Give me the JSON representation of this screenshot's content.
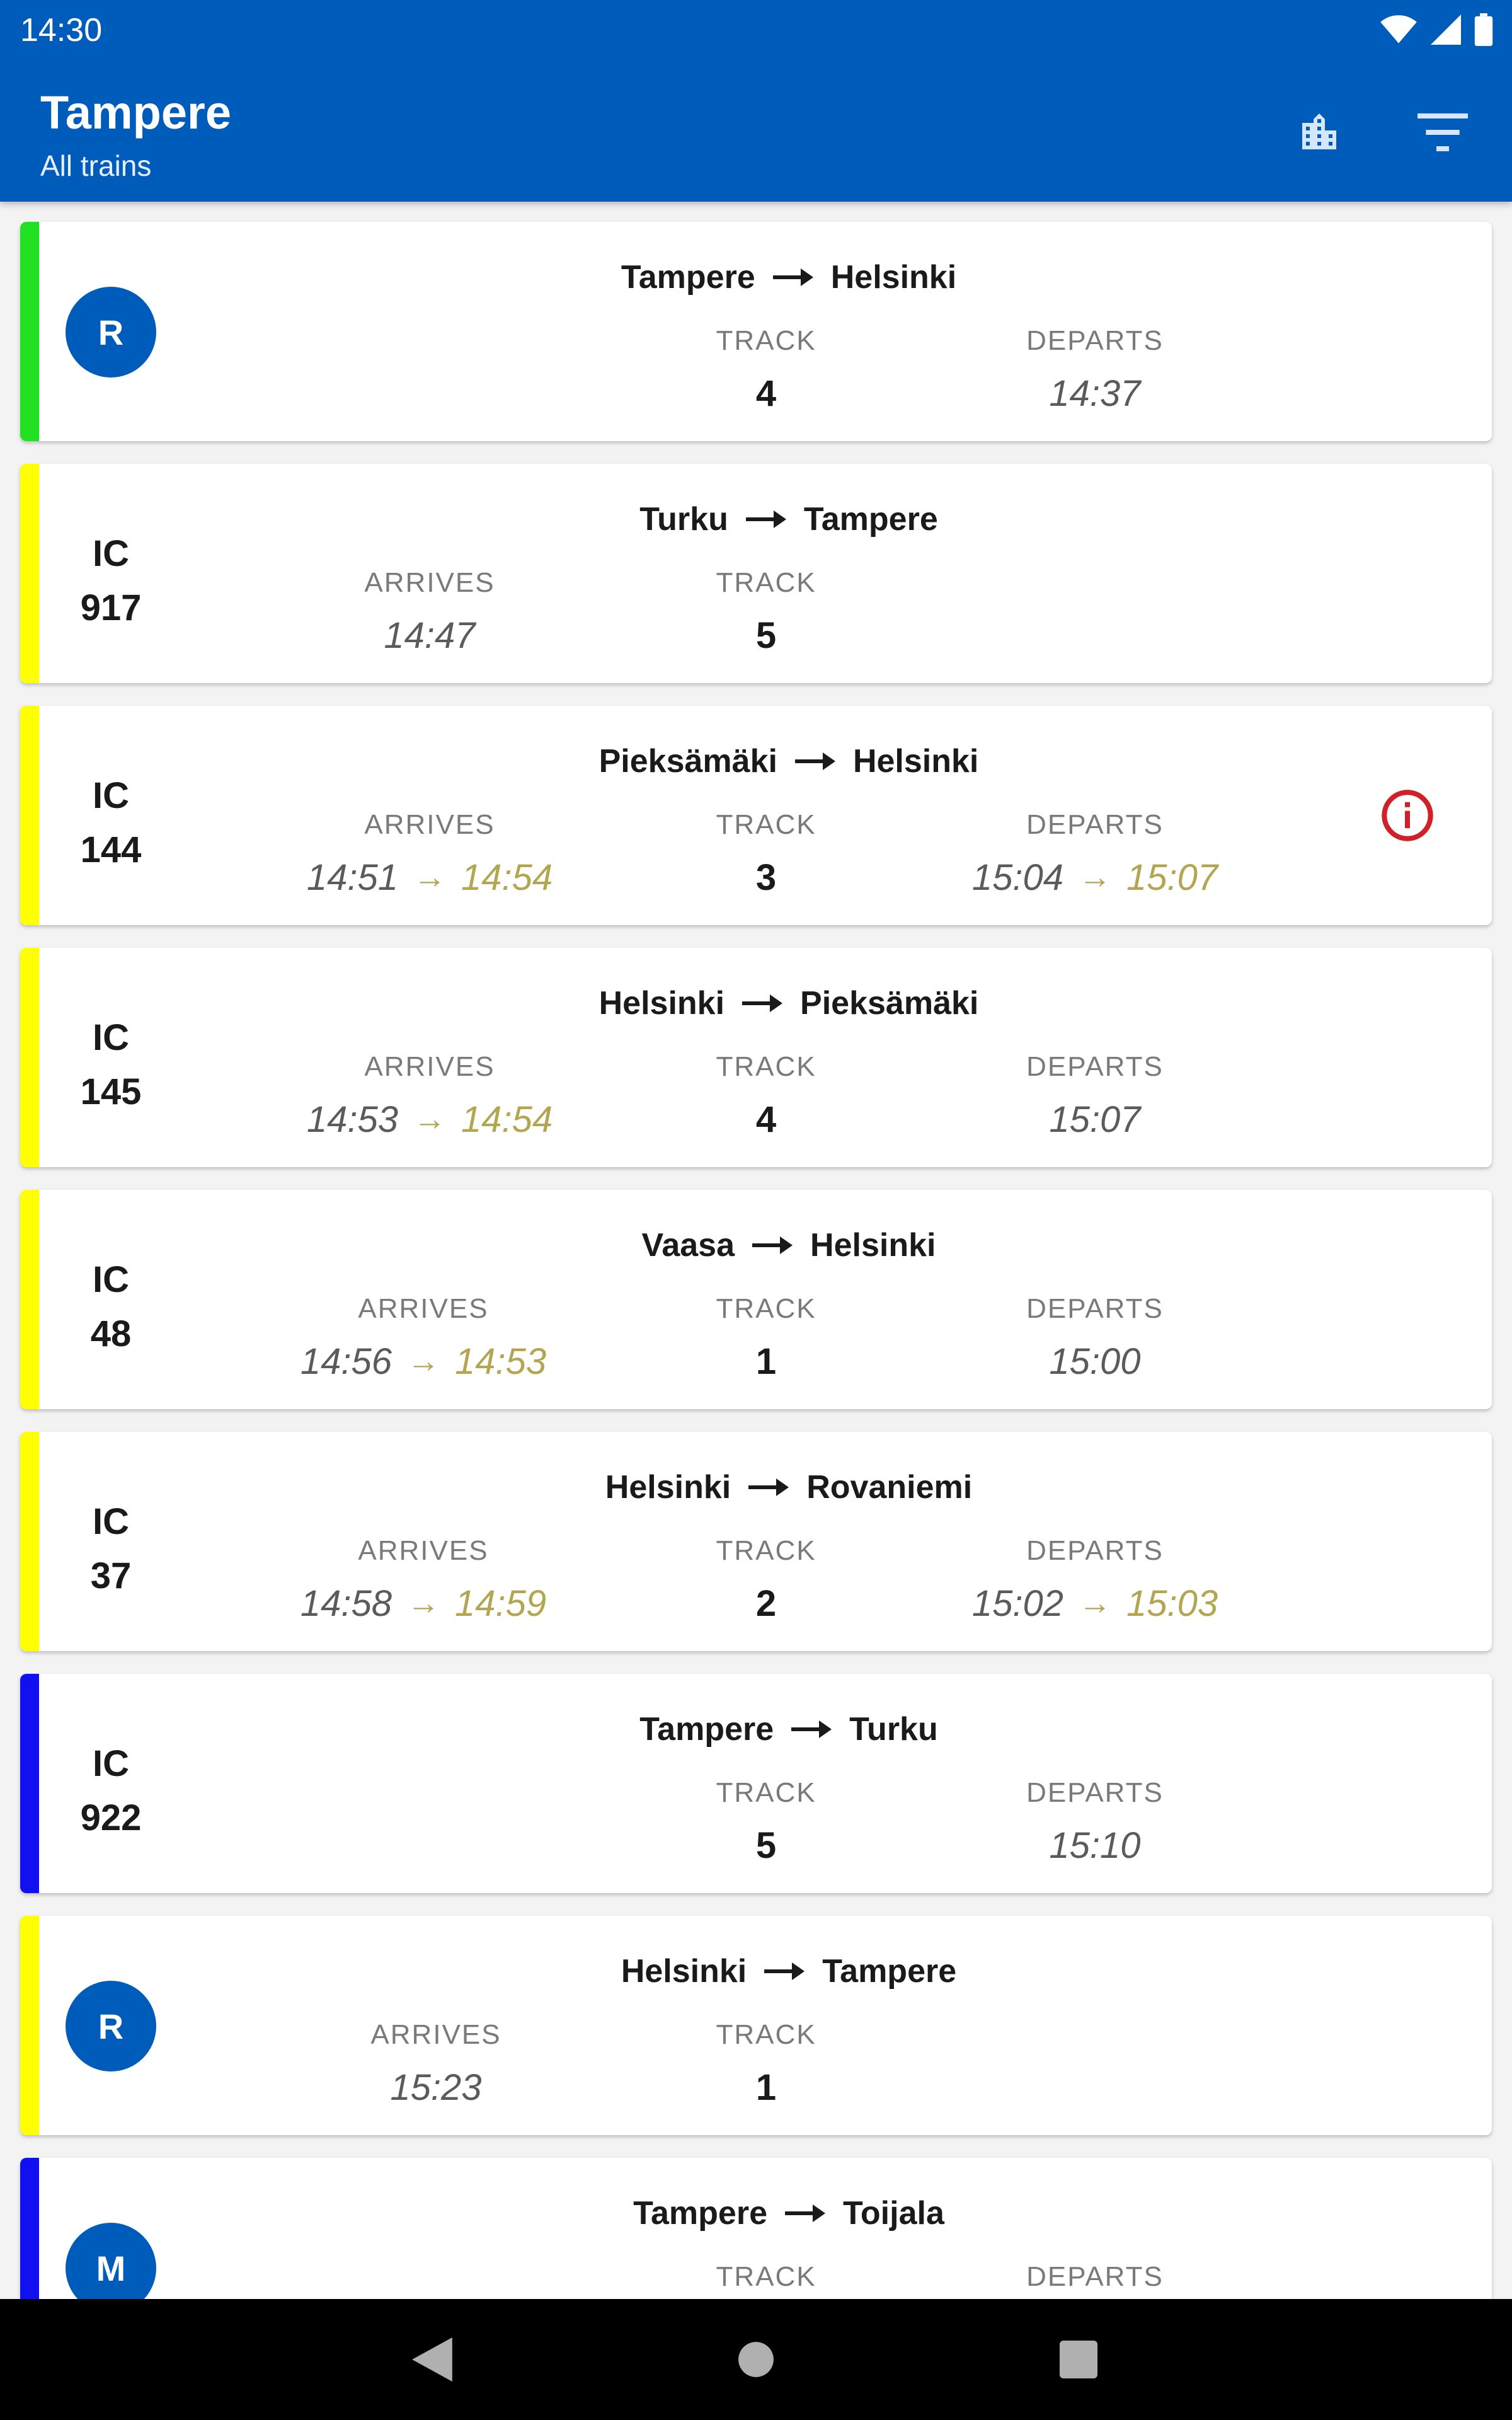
{
  "status": {
    "time": "14:30"
  },
  "appbar": {
    "title": "Tampere",
    "subtitle": "All trains"
  },
  "labels": {
    "arrives": "ARRIVES",
    "track": "TRACK",
    "departs": "DEPARTS"
  },
  "colors": {
    "primary": "#005cba",
    "delay": "#b3a651",
    "alert": "#d0202a",
    "stripe_green": "#22e022",
    "stripe_yellow": "#ffff00",
    "stripe_blue": "#1010f0"
  },
  "trains": [
    {
      "badge": "R",
      "from": "Tampere",
      "to": "Helsinki",
      "track": "4",
      "departs": "14:37",
      "stripe": "green"
    },
    {
      "type": "IC",
      "number": "917",
      "from": "Turku",
      "to": "Tampere",
      "arrives": "14:47",
      "track": "5",
      "stripe": "yellow"
    },
    {
      "type": "IC",
      "number": "144",
      "from": "Pieksämäki",
      "to": "Helsinki",
      "arrives": "14:51",
      "arrives_new": "14:54",
      "track": "3",
      "departs": "15:04",
      "departs_new": "15:07",
      "stripe": "yellow",
      "alert": true
    },
    {
      "type": "IC",
      "number": "145",
      "from": "Helsinki",
      "to": "Pieksämäki",
      "arrives": "14:53",
      "arrives_new": "14:54",
      "track": "4",
      "departs": "15:07",
      "stripe": "yellow"
    },
    {
      "type": "IC",
      "number": "48",
      "from": "Vaasa",
      "to": "Helsinki",
      "arrives": "14:56",
      "arrives_new": "14:53",
      "track": "1",
      "departs": "15:00",
      "stripe": "yellow"
    },
    {
      "type": "IC",
      "number": "37",
      "from": "Helsinki",
      "to": "Rovaniemi",
      "arrives": "14:58",
      "arrives_new": "14:59",
      "track": "2",
      "departs": "15:02",
      "departs_new": "15:03",
      "stripe": "yellow"
    },
    {
      "type": "IC",
      "number": "922",
      "from": "Tampere",
      "to": "Turku",
      "track": "5",
      "departs": "15:10",
      "stripe": "blue"
    },
    {
      "badge": "R",
      "from": "Helsinki",
      "to": "Tampere",
      "arrives": "15:23",
      "track": "1",
      "stripe": "yellow"
    },
    {
      "badge": "M",
      "from": "Tampere",
      "to": "Toijala",
      "stripe": "blue"
    }
  ]
}
